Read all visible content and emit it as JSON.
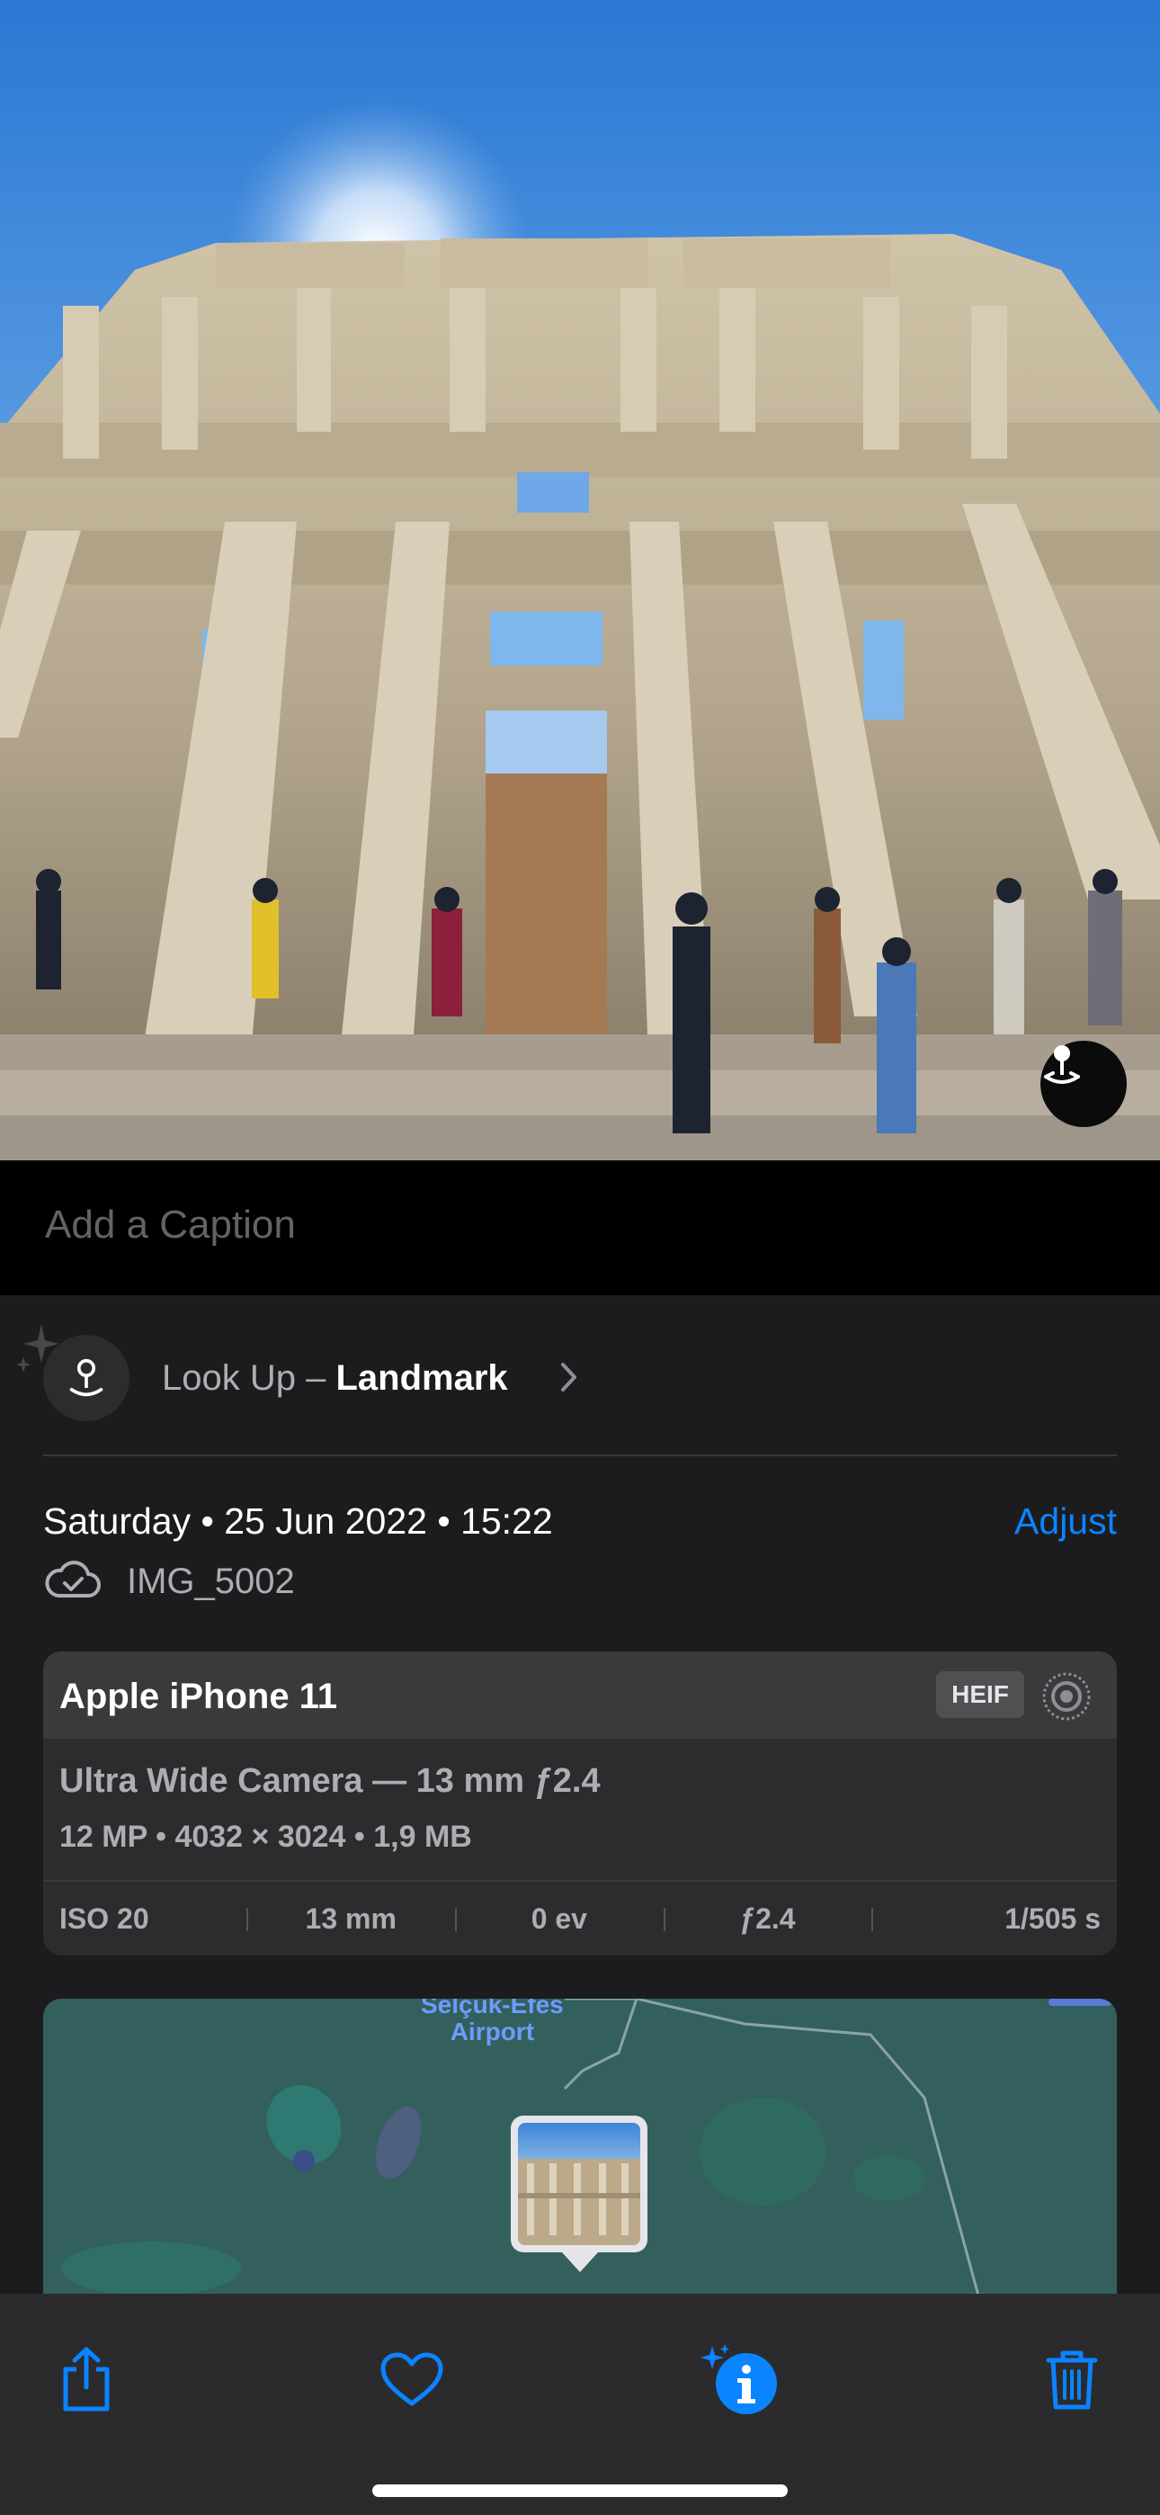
{
  "caption": {
    "placeholder": "Add a Caption"
  },
  "lookup": {
    "prefix": "Look Up – ",
    "subject": "Landmark",
    "icon": "location-pin-icon"
  },
  "metadata": {
    "date_line": "Saturday • 25 Jun 2022 • 15:22",
    "adjust_label": "Adjust",
    "filename": "IMG_5002",
    "cloud_icon": "icloud-synced-icon"
  },
  "exif": {
    "device": "Apple iPhone 11",
    "format_badge": "HEIF",
    "lens": "Ultra Wide Camera — 13 mm ƒ2.4",
    "specs": "12 MP  •  4032 × 3024  •  1,9 MB",
    "iso": "ISO 20",
    "focal": "13 mm",
    "exposure_comp": "0 ev",
    "aperture": "ƒ2.4",
    "shutter": "1/505 s"
  },
  "map": {
    "label_line1": "Selçuk-Efes",
    "label_line2": "Airport"
  },
  "toolbar": {
    "share": "share-icon",
    "favorite": "heart-icon",
    "info": "info-sparkle-icon",
    "delete": "trash-icon"
  },
  "colors": {
    "accent": "#0a84ff",
    "panel": "#1c1c1e",
    "card": "#2c2c2e"
  }
}
